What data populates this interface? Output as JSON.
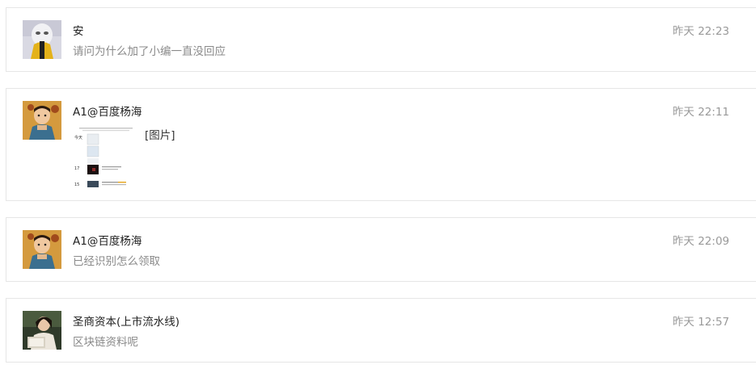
{
  "messages": [
    {
      "name": "安",
      "text": "请问为什么加了小编一直没回应",
      "time": "昨天 22:23",
      "avatar": "white-face-yellow-jacket"
    },
    {
      "name": "A1@百度杨海",
      "image_tag": "[图片]",
      "time": "昨天 22:11",
      "avatar": "child-photo",
      "thumb": {
        "today_label": "今天",
        "row1_day": "17",
        "row2_day": "15"
      }
    },
    {
      "name": "A1@百度杨海",
      "text": "已经识别怎么领取",
      "time": "昨天 22:09",
      "avatar": "child-photo"
    },
    {
      "name": "圣商资本(上市流水线)",
      "text": "区块链资料呢",
      "time": "昨天 12:57",
      "avatar": "reading-woman-photo"
    }
  ],
  "colors": {
    "border": "#e6e6e6",
    "name_text": "#222222",
    "secondary_text": "#8a8a8a",
    "time_text": "#999999"
  }
}
